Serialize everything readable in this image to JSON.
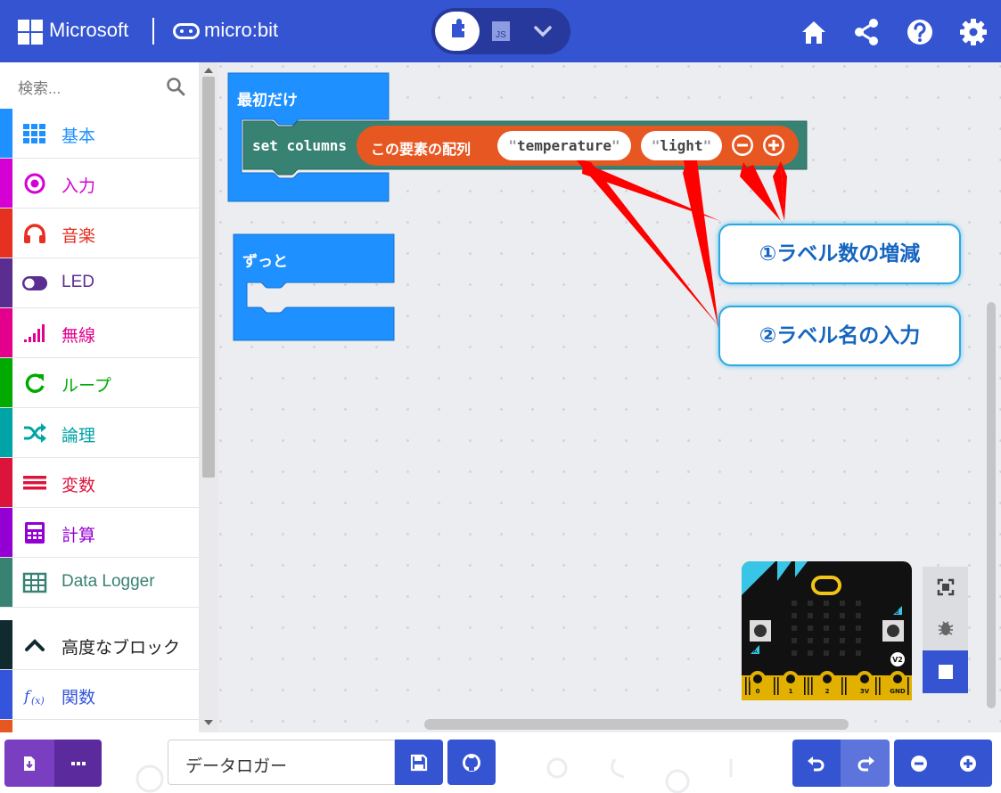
{
  "header": {
    "microsoft_label": "Microsoft",
    "microbit_label": "micro:bit",
    "js_label": "JS",
    "icons": [
      "home-icon",
      "share-icon",
      "help-icon",
      "settings-icon"
    ]
  },
  "toolbox": {
    "search_placeholder": "検索...",
    "categories": [
      {
        "label": "基本",
        "color": "#1e90ff",
        "icon": "grid-icon"
      },
      {
        "label": "入力",
        "color": "#d400d4",
        "icon": "target-icon"
      },
      {
        "label": "音楽",
        "color": "#e63022",
        "icon": "headphones-icon"
      },
      {
        "label": "LED",
        "color": "#5c2d91",
        "icon": "toggle-icon"
      },
      {
        "label": "無線",
        "color": "#e3008c",
        "icon": "signal-icon"
      },
      {
        "label": "ループ",
        "color": "#00aa00",
        "icon": "loop-icon"
      },
      {
        "label": "論理",
        "color": "#00a4a6",
        "icon": "shuffle-icon"
      },
      {
        "label": "変数",
        "color": "#dc143c",
        "icon": "lines-icon"
      },
      {
        "label": "計算",
        "color": "#9400d3",
        "icon": "calculator-icon"
      },
      {
        "label": "Data Logger",
        "color": "#378273",
        "icon": "table-icon"
      },
      {
        "label": "高度なブロック",
        "color": "#000000",
        "icon": "chevron-up-icon"
      },
      {
        "label": "関数",
        "color": "#3455db",
        "icon": "function-icon"
      }
    ]
  },
  "workspace": {
    "on_start_label": "最初だけ",
    "set_columns_label": "set columns",
    "array_label": "この要素の配列",
    "items": [
      "temperature",
      "light"
    ],
    "forever_label": "ずっと",
    "callout_1": "①ラベル数の増減",
    "callout_2": "②ラベル名の入力"
  },
  "simulator": {
    "pin_labels": [
      "0",
      "1",
      "2",
      "3V",
      "GND"
    ],
    "button_a": "A",
    "button_b": "B",
    "version_badge": "V2"
  },
  "bottom": {
    "project_name": "データロガー"
  },
  "colors": {
    "accent": "#3454d1",
    "block_blue": "#1e90ff",
    "datalogger": "#378273",
    "array_orange": "#e65722",
    "download": "#7a3ec0"
  }
}
